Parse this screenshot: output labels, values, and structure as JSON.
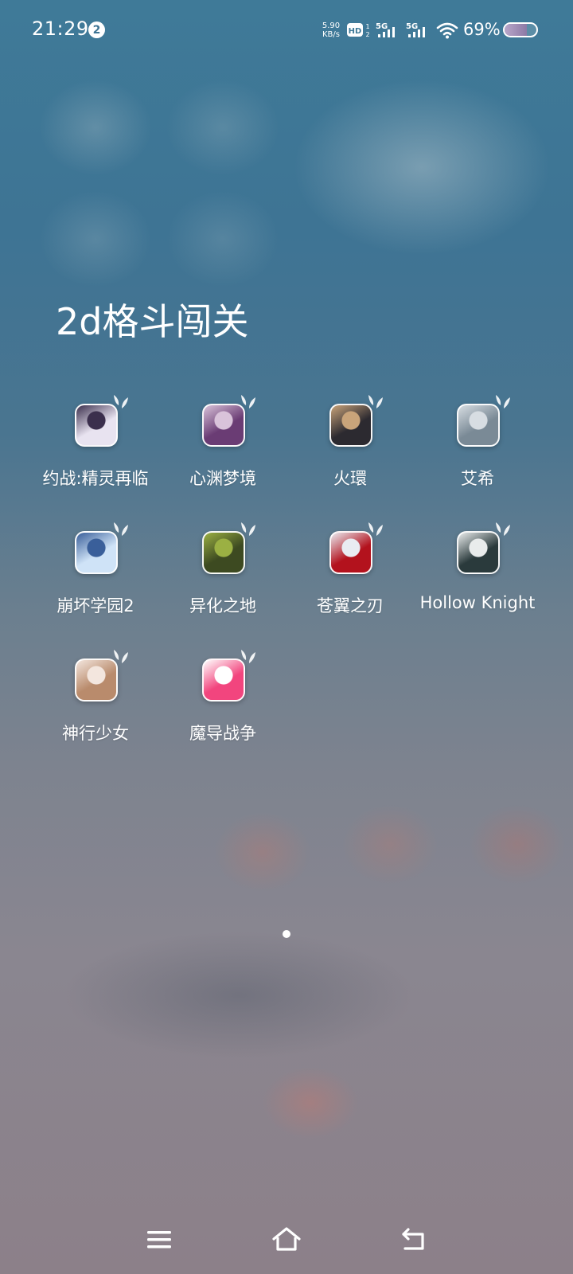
{
  "status_bar": {
    "time": "21:29",
    "notification_count": "2",
    "net_speed_value": "5.90",
    "net_speed_unit": "KB/s",
    "hd_label": "HD",
    "sim1_label": "5G",
    "sim2_label": "5G",
    "battery_percent": "69%",
    "battery_level": 0.69
  },
  "folder": {
    "title": "2d格斗闯关",
    "apps": [
      {
        "label": "约战:精灵再临",
        "icon": "date-a-live-icon",
        "colors": [
          "#e8e3f0",
          "#3b2f4d"
        ]
      },
      {
        "label": "心渊梦境",
        "icon": "xinyuan-dream-icon",
        "colors": [
          "#6a3c74",
          "#d9c3da"
        ]
      },
      {
        "label": "火環",
        "icon": "huohuan-icon",
        "colors": [
          "#2c2a30",
          "#c9a47a"
        ]
      },
      {
        "label": "艾希",
        "icon": "icey-icon",
        "colors": [
          "#7a8a96",
          "#d7dde2"
        ]
      },
      {
        "label": "崩坏学园2",
        "icon": "honkai-gakuen-2-icon",
        "colors": [
          "#cfe3f7",
          "#3a5f9a"
        ]
      },
      {
        "label": "异化之地",
        "icon": "alienated-land-icon",
        "colors": [
          "#3d4a21",
          "#9bb043"
        ]
      },
      {
        "label": "苍翼之刃",
        "icon": "blazblue-icon",
        "colors": [
          "#b3121d",
          "#e9ecf2"
        ]
      },
      {
        "label": "Hollow Knight",
        "icon": "hollow-knight-icon",
        "colors": [
          "#2a3a3c",
          "#e9ecec"
        ]
      },
      {
        "label": "神行少女",
        "icon": "shenxing-girl-icon",
        "colors": [
          "#b98b6c",
          "#f3e6de"
        ]
      },
      {
        "label": "魔导战争",
        "icon": "magic-war-goose-icon",
        "colors": [
          "#f2457e",
          "#ffffff"
        ]
      }
    ]
  },
  "page_indicator": {
    "current": 1,
    "total": 1
  },
  "nav_bar": {
    "menu": "menu-icon",
    "home": "home-icon",
    "back": "back-icon"
  }
}
